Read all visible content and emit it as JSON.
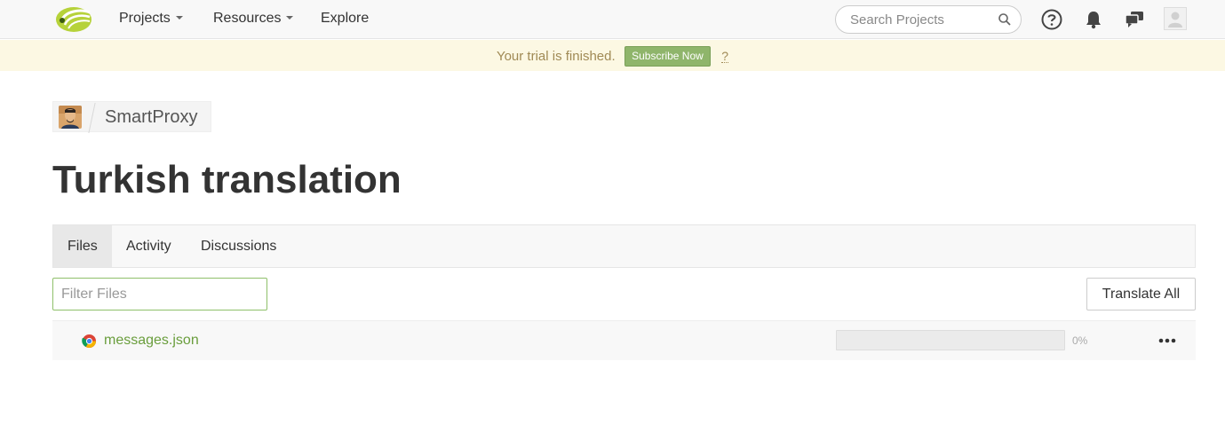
{
  "nav": {
    "items": [
      {
        "label": "Projects",
        "has_caret": true
      },
      {
        "label": "Resources",
        "has_caret": true
      },
      {
        "label": "Explore",
        "has_caret": false
      }
    ],
    "search_placeholder": "Search Projects",
    "icons": [
      "help-circle-icon",
      "bell-icon",
      "chat-bubbles-icon",
      "user-avatar-icon"
    ]
  },
  "banner": {
    "text": "Your trial is finished.",
    "subscribe_label": "Subscribe Now",
    "help_label": "?"
  },
  "breadcrumb": {
    "owner_avatar": "user-avatar",
    "project_name": "SmartProxy"
  },
  "page": {
    "title": "Turkish translation"
  },
  "tabs": [
    {
      "label": "Files",
      "active": true
    },
    {
      "label": "Activity",
      "active": false
    },
    {
      "label": "Discussions",
      "active": false
    }
  ],
  "toolbar": {
    "filter_placeholder": "Filter Files",
    "translate_all_label": "Translate All"
  },
  "files": [
    {
      "name": "messages.json",
      "icon": "chrome-icon",
      "progress": 0,
      "progress_label": "0%"
    }
  ],
  "colors": {
    "accent_green": "#8fb56b",
    "link_green": "#6a9e3d",
    "banner_bg": "#fcf8e3"
  }
}
